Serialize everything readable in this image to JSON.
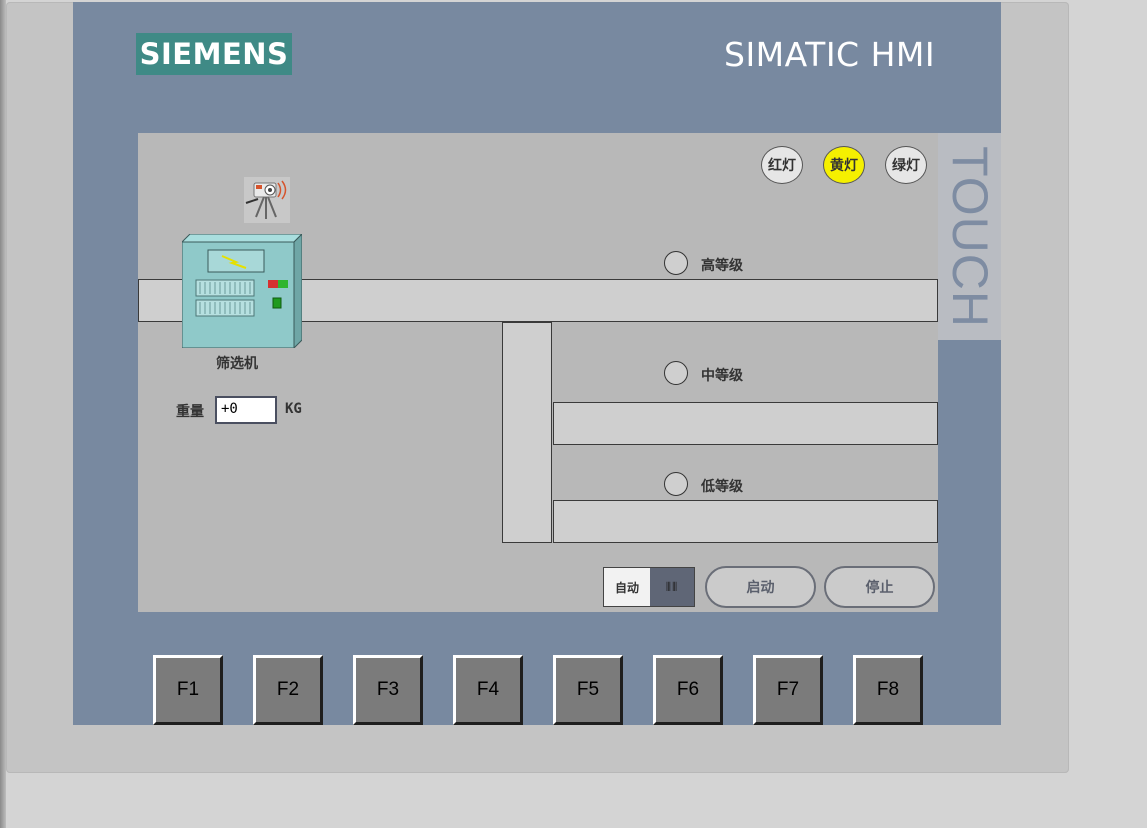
{
  "header": {
    "brand": "SIEMENS",
    "model": "SIMATIC HMI",
    "touch": "TOUCH"
  },
  "lamps": [
    {
      "label": "红灯",
      "on": false
    },
    {
      "label": "黄灯",
      "on": true
    },
    {
      "label": "绿灯",
      "on": false
    }
  ],
  "grades": {
    "high": "高等级",
    "mid": "中等级",
    "low": "低等级"
  },
  "machine": {
    "label": "筛选机"
  },
  "weight": {
    "label": "重量",
    "value": "+0",
    "unit": "KG"
  },
  "controls": {
    "mode_label": "自动",
    "mode_knob": "⦀⦀",
    "start": "启动",
    "stop": "停止"
  },
  "fkeys": [
    "F1",
    "F2",
    "F3",
    "F4",
    "F5",
    "F6",
    "F7",
    "F8"
  ]
}
